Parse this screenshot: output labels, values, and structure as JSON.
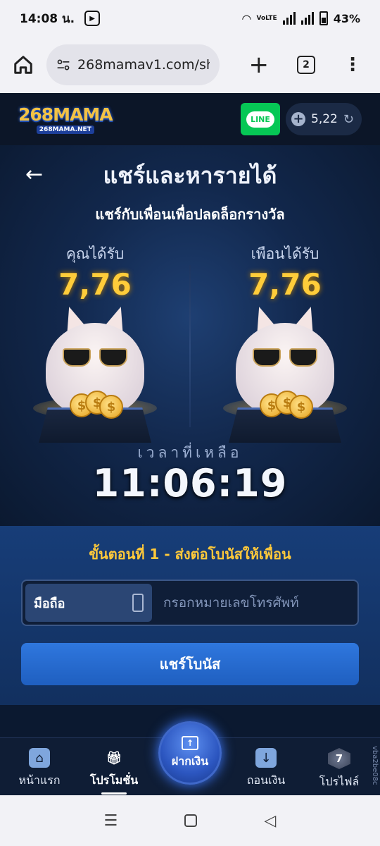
{
  "status_bar": {
    "time": "14:08 น.",
    "network": "VoLTE",
    "battery": "43%"
  },
  "browser": {
    "url": "268mamav1.com/sha",
    "tab_count": "2"
  },
  "header": {
    "logo_main": "268MAMA",
    "logo_sub": "268MAMA.NET",
    "line_label": "LINE",
    "balance": "5,22"
  },
  "hero": {
    "title": "แชร์และหารายได้",
    "subtitle": "แชร์กับเพื่อนเพื่อปลดล็อกรางวัล",
    "you_label": "คุณได้รับ",
    "you_value": "7,76",
    "friend_label": "เพือนได้รับ",
    "friend_value": "7,76",
    "timer_label": "เวลาที่เหลือ",
    "timer_value": "11:06:19"
  },
  "step": {
    "title": "ขั้นตอนที่ 1 - ส่งต่อโบนัสให้เพื่อน",
    "phone_type": "มือถือ",
    "phone_placeholder": "กรอกหมายเลขโทรศัพท์",
    "share_button": "แชร์โบนัส"
  },
  "bottom_nav": {
    "home": "หน้าแรก",
    "promotions": "โปรโมชั่น",
    "deposit": "ฝากเงิน",
    "withdraw": "ถอนเงิน",
    "profile": "โปรไฟล์",
    "vip_level": "7"
  },
  "side_tag": "vba2be08c",
  "colors": {
    "accent_gold": "#ffcc3a",
    "primary_blue": "#2f77de",
    "line_green": "#06c755"
  }
}
